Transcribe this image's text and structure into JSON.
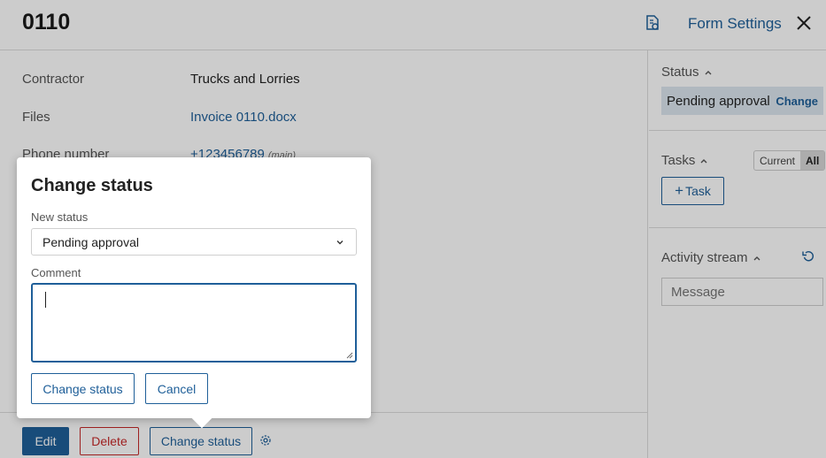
{
  "header": {
    "title": "0110",
    "form_settings_label": "Form Settings"
  },
  "fields": [
    {
      "label": "Contractor",
      "value": "Trucks and Lorries",
      "type": "text"
    },
    {
      "label": "Files",
      "value": "Invoice 0110.docx",
      "type": "link"
    },
    {
      "label": "Phone number",
      "value": "+123456789",
      "tag": "(main)",
      "type": "link"
    }
  ],
  "actions": {
    "edit_label": "Edit",
    "delete_label": "Delete",
    "change_status_label": "Change status"
  },
  "sidebar": {
    "status_title": "Status",
    "status_value": "Pending approval",
    "status_change_label": "Change",
    "tasks_title": "Tasks",
    "tasks_filter": {
      "current_label": "Current",
      "all_label": "All",
      "selected": "All"
    },
    "add_task_label": "Task",
    "activity_title": "Activity stream",
    "message_placeholder": "Message"
  },
  "modal": {
    "title": "Change status",
    "new_status_label": "New status",
    "new_status_value": "Pending approval",
    "comment_label": "Comment",
    "comment_value": "",
    "confirm_label": "Change status",
    "cancel_label": "Cancel"
  },
  "colors": {
    "accent": "#1f5f99",
    "danger": "#c62828",
    "status_bg": "#dde7ef"
  }
}
